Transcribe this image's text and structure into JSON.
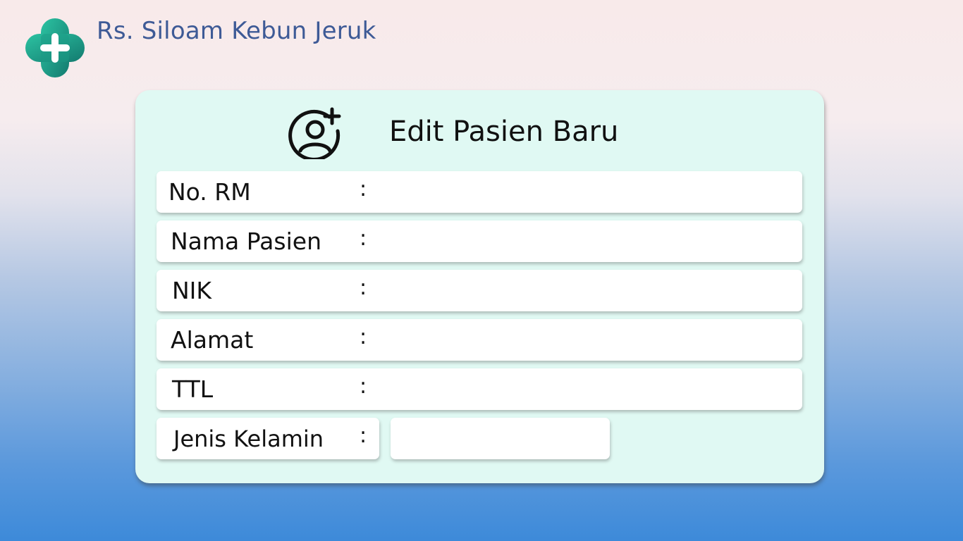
{
  "header": {
    "hospital_name": "Rs. Siloam Kebun Jeruk",
    "logo_icon": "medical-cross-icon"
  },
  "form": {
    "title": "Edit Pasien Baru",
    "title_icon": "add-user-icon",
    "fields": [
      {
        "label": "No. RM",
        "separator": ":",
        "value": ""
      },
      {
        "label": "Nama Pasien",
        "separator": ":",
        "value": ""
      },
      {
        "label": "NIK",
        "separator": ":",
        "value": ""
      },
      {
        "label": "Alamat",
        "separator": ":",
        "value": ""
      },
      {
        "label": "TTL",
        "separator": ":",
        "value": ""
      },
      {
        "label": "Jenis Kelamin",
        "separator": ":",
        "value": ""
      }
    ]
  },
  "colors": {
    "brand_text": "#3e5a96",
    "logo_teal": "#1fa88f",
    "card_background": "#e0f9f3",
    "gradient_top": "#f8eaea",
    "gradient_bottom": "#3d8ad9"
  }
}
